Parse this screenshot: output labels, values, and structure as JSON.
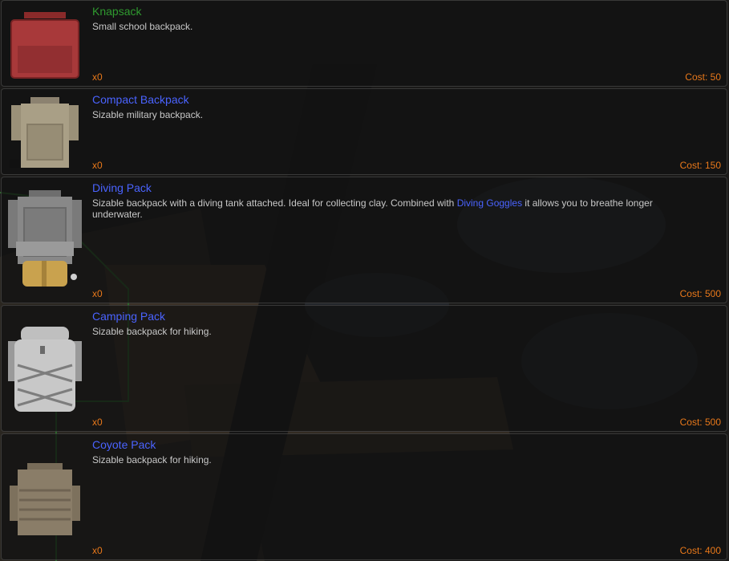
{
  "colors": {
    "name_green": "#2f9a2f",
    "name_blue": "#4a63ff",
    "text_gray": "#c8c8c8",
    "accent_orange": "#e8781a",
    "panel_bg": "#121212"
  },
  "items": [
    {
      "name": "Knapsack",
      "name_color": "green",
      "icon": "red-knapsack-icon",
      "desc": "Small school backpack.",
      "qty": "x0",
      "cost": "Cost: 50"
    },
    {
      "name": "Compact Backpack",
      "name_color": "blue",
      "icon": "tan-compact-backpack-icon",
      "desc": "Sizable military backpack.",
      "qty": "x0",
      "cost": "Cost: 150"
    },
    {
      "name": "Diving Pack",
      "name_color": "blue",
      "icon": "gray-diving-pack-icon",
      "desc_before": "Sizable backpack with a diving tank attached. Ideal for collecting clay. Combined with ",
      "desc_link": "Diving Goggles",
      "desc_after": " it allows you to breathe longer underwater.",
      "qty": "x0",
      "cost": "Cost: 500"
    },
    {
      "name": "Camping Pack",
      "name_color": "blue",
      "icon": "light-gray-camping-pack-icon",
      "desc": "Sizable backpack for hiking.",
      "qty": "x0",
      "cost": "Cost: 500"
    },
    {
      "name": "Coyote Pack",
      "name_color": "blue",
      "icon": "coyote-pack-icon",
      "desc": "Sizable backpack for hiking.",
      "qty": "x0",
      "cost": "Cost: 400"
    }
  ]
}
